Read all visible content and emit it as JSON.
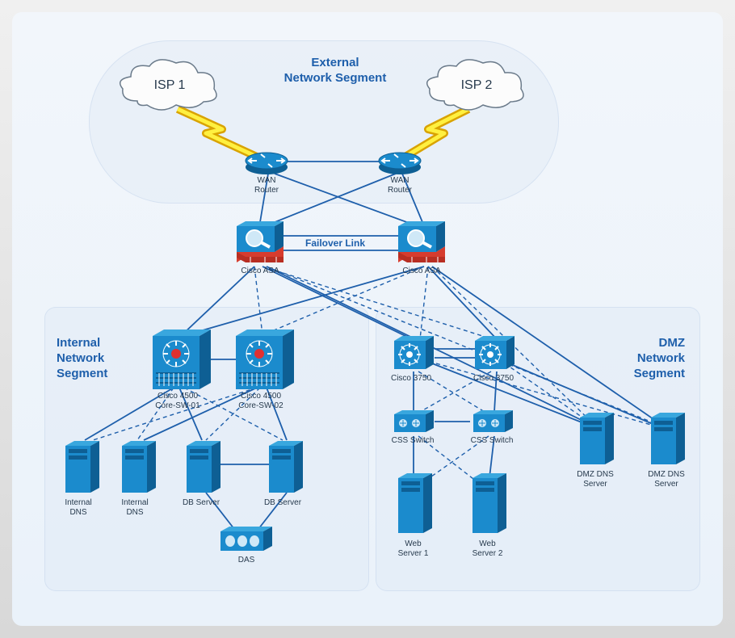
{
  "segments": {
    "external": {
      "title": "External\nNetwork Segment"
    },
    "internal": {
      "title": "Internal\nNetwork\nSegment"
    },
    "dmz": {
      "title": "DMZ\nNetwork\nSegment"
    }
  },
  "labels": {
    "isp1": "ISP 1",
    "isp2": "ISP 2",
    "wanRouter1": "WAN\nRouter",
    "wanRouter2": "WAN\nRouter",
    "failover": "Failover Link",
    "asa1": "Cisco ASA",
    "asa2": "Cisco ASA",
    "core1": "Cisco 4500\nCore-SW-01",
    "core2": "Cisco 4500\nCore-SW-02",
    "intDns1": "Internal\nDNS",
    "intDns2": "Internal\nDNS",
    "db1": "DB Server",
    "db2": "DB Server",
    "das": "DAS",
    "c3750a": "Cisco 3750",
    "c3750b": "Cisco 3750",
    "css1": "CSS Switch",
    "css2": "CSS Switch",
    "web1": "Web\nServer 1",
    "web2": "Web\nServer 2",
    "dmzDns1": "DMZ DNS\nServer",
    "dmzDns2": "DMZ DNS\nServer"
  },
  "colors": {
    "azure": "#1b8bcd",
    "azureDark": "#0e5f94",
    "red": "#e03030",
    "line": "#1e5fab",
    "dash": "#1e5fab"
  }
}
